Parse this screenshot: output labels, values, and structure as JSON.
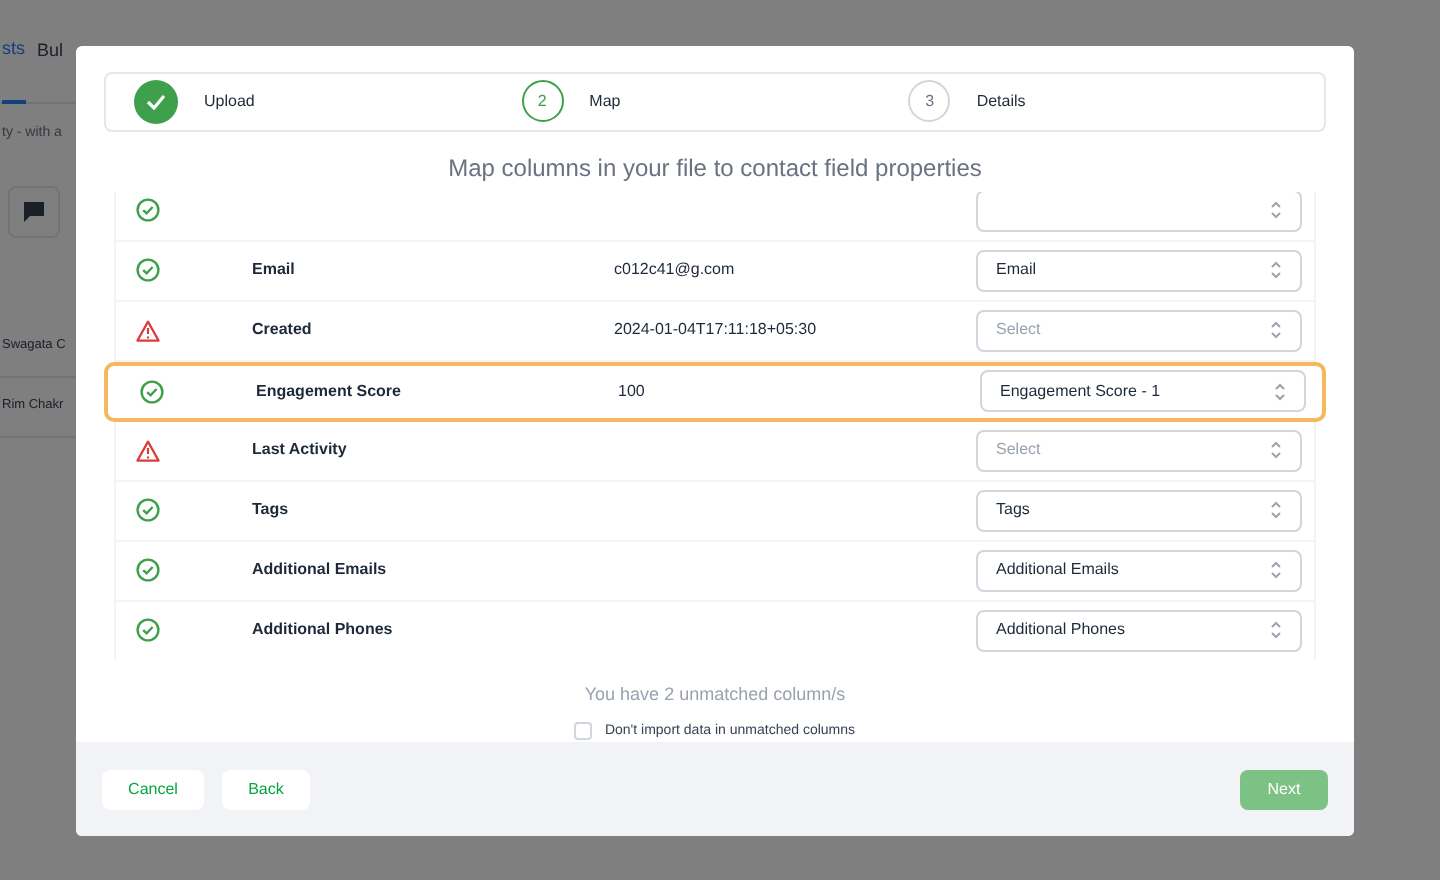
{
  "background_page": {
    "tabs": [
      {
        "label": "sts",
        "selected": true
      },
      {
        "label": "Bul",
        "selected": false
      }
    ],
    "subtitle": "ty - with a",
    "rows": [
      "Swagata C",
      "Rim Chakr"
    ]
  },
  "stepper": [
    {
      "label": "Upload",
      "kind": "done"
    },
    {
      "number": "2",
      "label": "Map",
      "kind": "current"
    },
    {
      "number": "3",
      "label": "Details",
      "kind": "upcoming"
    }
  ],
  "instruction": "Map columns in your file to contact field properties",
  "mapping_rows": [
    {
      "kind": "matched",
      "highlighted": false
    },
    {
      "kind": "matched",
      "column": "Email",
      "sample": "c012c41@g.com",
      "property": {
        "value": "Email"
      },
      "highlighted": false
    },
    {
      "kind": "unmatched",
      "column": "Created",
      "sample": "2024-01-04T17:11:18+05:30",
      "property": {
        "placeholder": "Select"
      },
      "highlighted": false
    },
    {
      "kind": "matched",
      "column": "Engagement Score",
      "sample": "100",
      "property": {
        "value": "Engagement Score - 1"
      },
      "highlighted": true
    },
    {
      "kind": "unmatched",
      "column": "Last Activity",
      "property": {
        "placeholder": "Select"
      },
      "highlighted": false
    },
    {
      "kind": "matched",
      "column": "Tags",
      "property": {
        "value": "Tags"
      },
      "highlighted": false
    },
    {
      "kind": "matched",
      "column": "Additional Emails",
      "property": {
        "value": "Additional Emails"
      },
      "highlighted": false
    },
    {
      "kind": "matched",
      "column": "Additional Phones",
      "property": {
        "value": "Additional Phones"
      },
      "highlighted": false
    }
  ],
  "unmatched_note": "You have 2 unmatched column/s",
  "skip_unmatched": {
    "label": "Don't import data in unmatched columns",
    "checked": false
  },
  "buttons": {
    "cancel": "Cancel",
    "back": "Back",
    "next": "Next"
  }
}
